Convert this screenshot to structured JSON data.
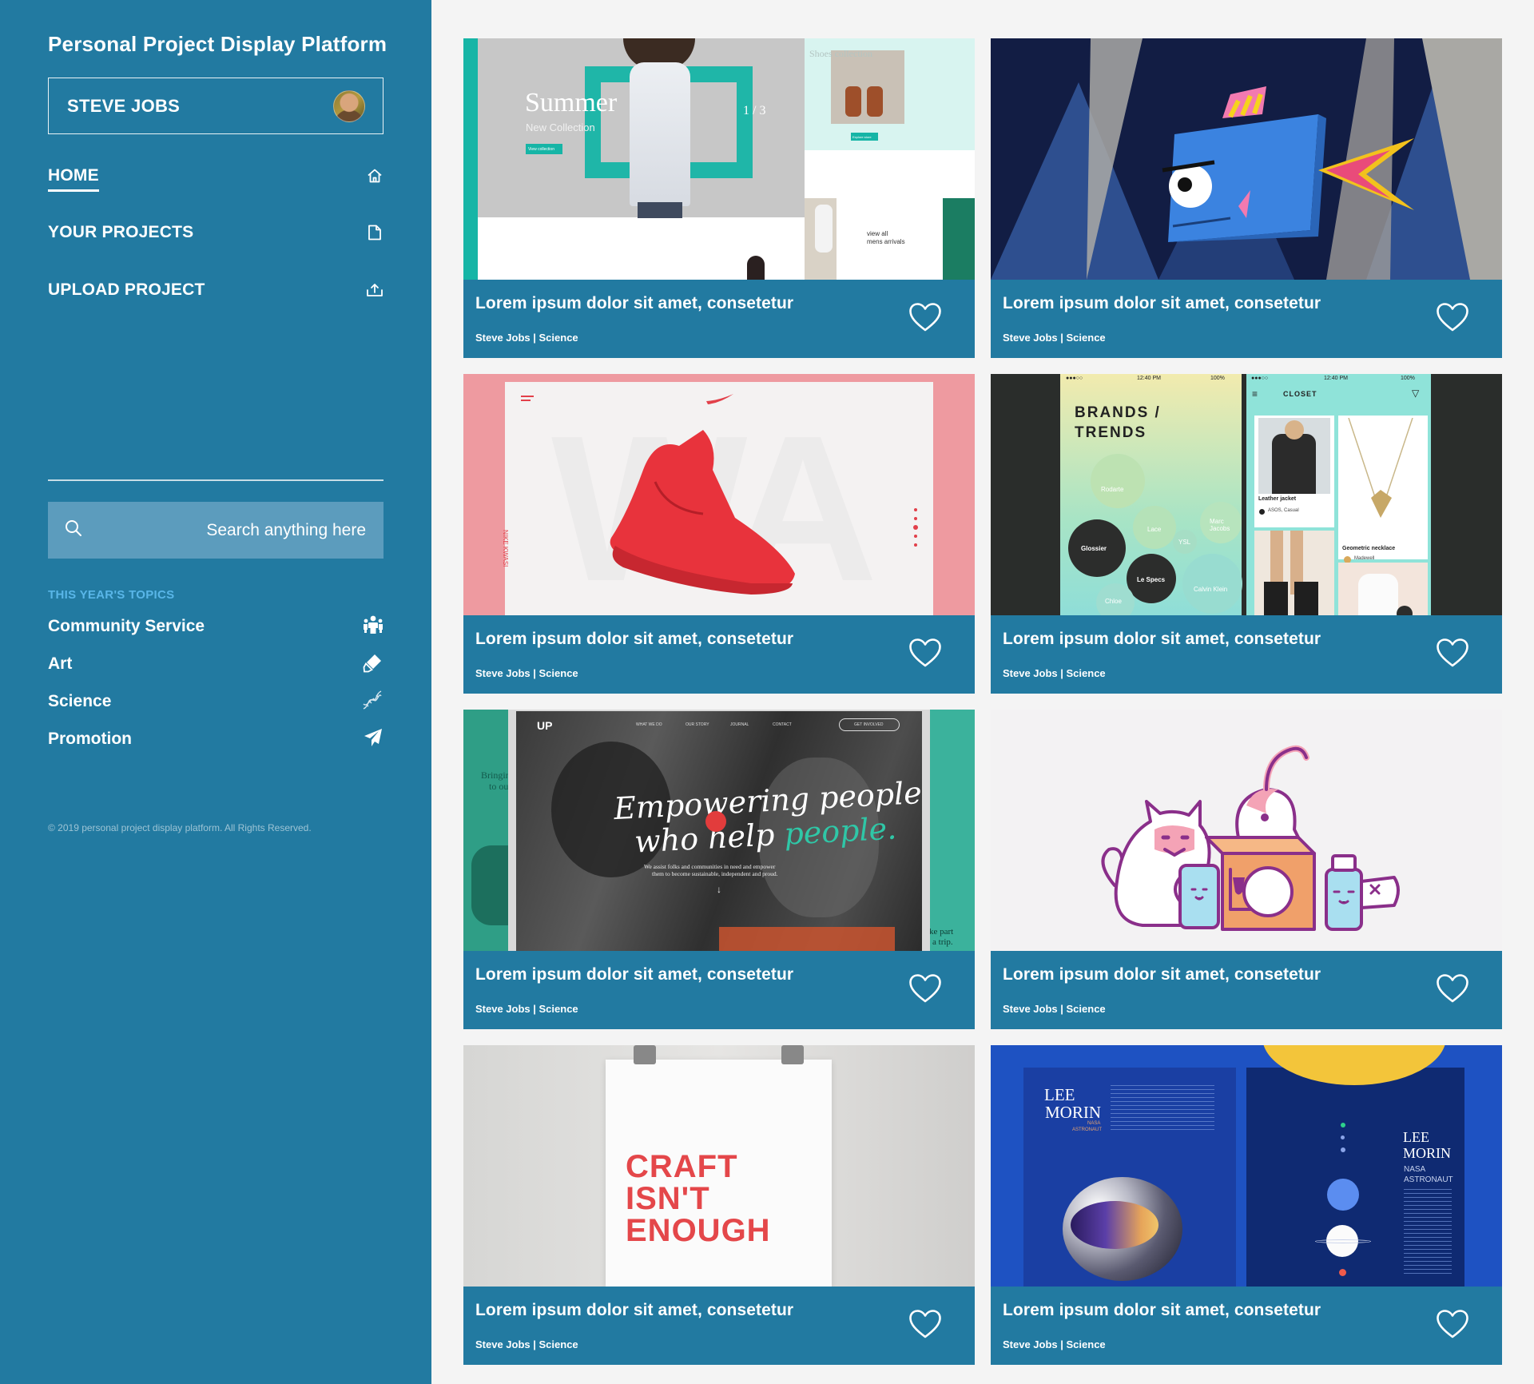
{
  "sidebar": {
    "brand": "Personal Project Display Platform",
    "user": {
      "name": "STEVE JOBS"
    },
    "nav": [
      {
        "label": "HOME",
        "icon": "home-icon",
        "active": true
      },
      {
        "label": "YOUR PROJECTS",
        "icon": "document-icon",
        "active": false
      },
      {
        "label": "UPLOAD PROJECT",
        "icon": "upload-icon",
        "active": false
      }
    ],
    "search": {
      "placeholder": "Search anything here"
    },
    "topics_heading": "THIS YEAR'S TOPICS",
    "topics": [
      {
        "label": "Community Service",
        "icon": "people-icon"
      },
      {
        "label": "Art",
        "icon": "brush-icon"
      },
      {
        "label": "Science",
        "icon": "dna-icon"
      },
      {
        "label": "Promotion",
        "icon": "paper-plane-icon"
      }
    ],
    "copyright": "© 2019 personal project display platform. All Rights Reserved."
  },
  "projects": [
    {
      "title": "Lorem ipsum dolor sit amet, consetetur",
      "meta": "Steve Jobs | Science",
      "thumb": "fashion-site"
    },
    {
      "title": "Lorem ipsum dolor sit amet, consetetur",
      "meta": "Steve Jobs | Science",
      "thumb": "paper-fish"
    },
    {
      "title": "Lorem ipsum dolor sit amet, consetetur",
      "meta": "Steve Jobs | Science",
      "thumb": "red-sneaker"
    },
    {
      "title": "Lorem ipsum dolor sit amet, consetetur",
      "meta": "Steve Jobs | Science",
      "thumb": "fashion-app"
    },
    {
      "title": "Lorem ipsum dolor sit amet, consetetur",
      "meta": "Steve Jobs | Science",
      "thumb": "charity-site"
    },
    {
      "title": "Lorem ipsum dolor sit amet, consetetur",
      "meta": "Steve Jobs | Science",
      "thumb": "cats-illustration"
    },
    {
      "title": "Lorem ipsum dolor sit amet, consetetur",
      "meta": "Steve Jobs | Science",
      "thumb": "craft-poster"
    },
    {
      "title": "Lorem ipsum dolor sit amet, consetetur",
      "meta": "Steve Jobs | Science",
      "thumb": "astronaut-book"
    }
  ],
  "thumb_text": {
    "fashion": {
      "headline": "Summer",
      "sub": "New Collection",
      "cta": "View collection",
      "pager": "1 / 3",
      "view_all_1": "view all",
      "view_all_2": "mens arrivals",
      "shoes": "Shoes collection",
      "explore": "Explore store"
    },
    "sneaker": {
      "side": "NIKE KWASI"
    },
    "app": {
      "time": "12:40 PM",
      "battery": "100%",
      "brands_1": "BRANDS /",
      "brands_2": "TRENDS",
      "closet": "CLOSET",
      "b1": "Rodarte",
      "b2": "Lace",
      "b3": "Marc Jacobs",
      "b4": "Glossier",
      "b5": "YSL",
      "b6": "Le Specs",
      "b7": "Chloe",
      "b8": "Calvin Klein",
      "item1": "Leather jacket",
      "item1_sub": "ASOS, Casual",
      "item2": "Geometric necklace",
      "item2_sub": "Madewell"
    },
    "charity": {
      "logo": "UP",
      "menu": [
        "WHAT WE DO",
        "OUR STORY",
        "JOURNAL",
        "CONTACT"
      ],
      "cta": "GET INVOLVED",
      "line1": "Empowering people",
      "line2a": "who help ",
      "line2b": "people.",
      "body1": "We assist folks and communities in need and empower",
      "body2": "them to become sustainable, independent and proud.",
      "left": "Bringing",
      "left2": "to ou",
      "right1": "ke part",
      "right2": "a trip."
    },
    "poster": {
      "line1": "CRAFT",
      "line2": "ISN'T",
      "line3": "ENOUGH"
    },
    "book": {
      "name1": "LEE",
      "name2": "MORIN",
      "role1": "NASA",
      "role2": "ASTRONAUT"
    }
  },
  "colors": {
    "sidebar": "#227aa1",
    "accent": "#59b6e8",
    "search_bg": "#5c9cbd",
    "page_bg": "#f4f4f4"
  }
}
